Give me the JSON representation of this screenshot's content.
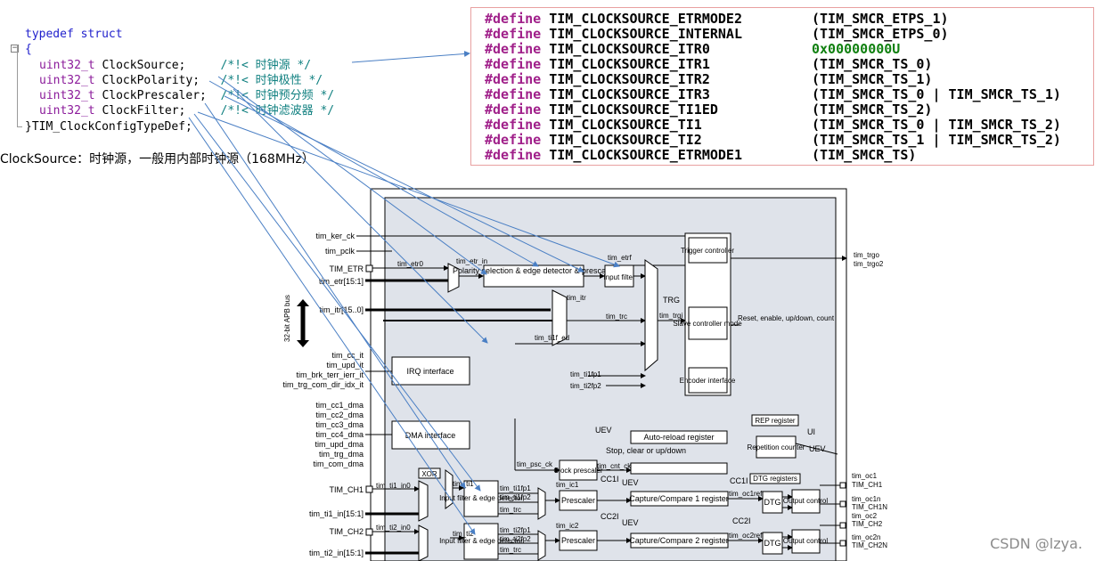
{
  "code": {
    "lines": [
      {
        "kw": "typedef",
        "kw2": "struct"
      },
      {
        "text": "{"
      },
      {
        "type": "uint32_t",
        "field": "ClockSource;",
        "comment": "/*!< 时钟源 */"
      },
      {
        "type": "uint32_t",
        "field": "ClockPolarity;",
        "comment": "/*!< 时钟极性 */"
      },
      {
        "type": "uint32_t",
        "field": "ClockPrescaler;",
        "comment": "/*!< 时钟预分频 */"
      },
      {
        "type": "uint32_t",
        "field": "ClockFilter;",
        "comment": "/*!< 时钟滤波器 */"
      },
      {
        "text": "}TIM_ClockConfigTypeDef;"
      }
    ]
  },
  "description": "ClockSource：时钟源，一般用内部时钟源（168MHz）",
  "defines": [
    {
      "kw": "#define",
      "name": "TIM_CLOCKSOURCE_ETRMODE2",
      "value": "(TIM_SMCR_ETPS_1)",
      "hex": false
    },
    {
      "kw": "#define",
      "name": "TIM_CLOCKSOURCE_INTERNAL",
      "value": "(TIM_SMCR_ETPS_0)",
      "hex": false
    },
    {
      "kw": "#define",
      "name": "TIM_CLOCKSOURCE_ITR0",
      "value": "0x00000000U",
      "hex": true
    },
    {
      "kw": "#define",
      "name": "TIM_CLOCKSOURCE_ITR1",
      "value": "(TIM_SMCR_TS_0)",
      "hex": false
    },
    {
      "kw": "#define",
      "name": "TIM_CLOCKSOURCE_ITR2",
      "value": "(TIM_SMCR_TS_1)",
      "hex": false
    },
    {
      "kw": "#define",
      "name": "TIM_CLOCKSOURCE_ITR3",
      "value": "(TIM_SMCR_TS_0 | TIM_SMCR_TS_1)",
      "hex": false
    },
    {
      "kw": "#define",
      "name": "TIM_CLOCKSOURCE_TI1ED",
      "value": "(TIM_SMCR_TS_2)",
      "hex": false
    },
    {
      "kw": "#define",
      "name": "TIM_CLOCKSOURCE_TI1",
      "value": "(TIM_SMCR_TS_0 | TIM_SMCR_TS_2)",
      "hex": false
    },
    {
      "kw": "#define",
      "name": "TIM_CLOCKSOURCE_TI2",
      "value": "(TIM_SMCR_TS_1 | TIM_SMCR_TS_2)",
      "hex": false
    },
    {
      "kw": "#define",
      "name": "TIM_CLOCKSOURCE_ETRMODE1",
      "value": "(TIM_SMCR_TS)",
      "hex": false
    }
  ],
  "diagram": {
    "inputs": [
      "tim_ker_ck",
      "tim_pclk",
      "TIM_ETR",
      "tim_etr[15:1]",
      "tim_itr[15..0]",
      "tim_cc_it",
      "tim_upd_it",
      "tim_brk_terr_ierr_it",
      "tim_trg_com_dir_idx_it",
      "tim_cc1_dma",
      "tim_cc2_dma",
      "tim_cc3_dma",
      "tim_cc4_dma",
      "tim_upd_dma",
      "tim_trg_dma",
      "tim_com_dma",
      "TIM_CH1",
      "tim_ti1_in[15:1]",
      "TIM_CH2",
      "tim_ti2_in[15:1]"
    ],
    "bus": "32-bit APB bus",
    "blocks": {
      "polarity": "Polarity selection & edge detector & prescaler",
      "input_filter": "Input filter",
      "trigger": "Trigger controller",
      "slave": "Slave controller mode",
      "encoder": "Encoder interface",
      "irq": "IRQ interface",
      "dma": "DMA interface",
      "rep": "REP register",
      "repcount": "Repetition counter",
      "autoreload": "Auto-reload register",
      "stopclear": "Stop, clear or up/down",
      "clockpsc": "Clock prescaler",
      "xor": "XOR",
      "ifed1": "Input filter & edge detector",
      "ifed2": "Input filter & edge detector",
      "psc1": "Prescaler",
      "psc2": "Prescaler",
      "cc1": "Capture/Compare 1 register",
      "cc2": "Capture/Compare 2 register",
      "dtgreg": "DTG registers",
      "dtg1": "DTG",
      "dtg2": "DTG",
      "oc1": "Output control",
      "oc2": "Output control"
    },
    "signals": {
      "etr0": "tim_etr0",
      "etr_in": "tim_etr_in",
      "etrf": "tim_etrf",
      "itr": "tim_itr",
      "trc": "tim_trc",
      "trgi": "tim_trgi",
      "trg": "TRG",
      "ti1f_ed": "tim_ti1f_ed",
      "ti1fp1": "tim_ti1fp1",
      "ti2fp2": "tim_ti2fp2",
      "reset": "Reset, enable, up/down, count",
      "trgo": "tim_trgo",
      "trgo2": "tim_trgo2",
      "uev": "UEV",
      "ui": "UI",
      "psc_ck": "tim_psc_ck",
      "cnt_ck": "tim_cnt_ck",
      "ti1_in0": "tim_ti1_in0",
      "ti2_in0": "tim_ti2_in0",
      "ti1": "tim_ti1",
      "ti2": "tim_ti2",
      "ic1": "tim_ic1",
      "ic2": "tim_ic2",
      "cc1i": "CC1I",
      "cc2i": "CC2I",
      "oc1ref": "tim_oc1ref",
      "oc2ref": "tim_oc2ref",
      "ti1fp1b": "tim_ti1fp1",
      "ti1fp2b": "tim_ti1fp2",
      "trc1": "tim_trc",
      "ti2fp1b": "tim_ti2fp1",
      "ti2fp2b": "tim_ti2fp2",
      "trc2": "tim_trc"
    },
    "outputs": [
      "tim_oc1",
      "TIM_CH1",
      "tim_oc1n",
      "TIM_CH1N",
      "tim_oc2",
      "TIM_CH2",
      "tim_oc2n",
      "TIM_CH2N"
    ]
  },
  "watermark": "CSDN @lzya."
}
